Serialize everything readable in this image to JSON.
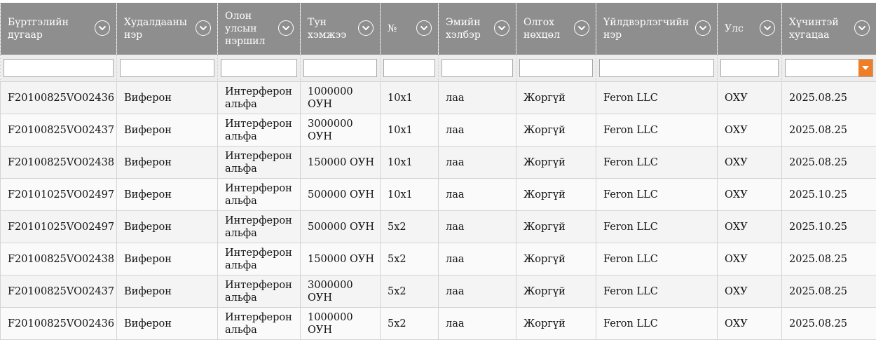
{
  "columns": [
    {
      "label": "Бүртгэлийн дугаар"
    },
    {
      "label": "Худалдааны нэр"
    },
    {
      "label": "Олон улсын нэршил"
    },
    {
      "label": "Тун хэмжээ"
    },
    {
      "label": "№"
    },
    {
      "label": "Эмийн хэлбэр"
    },
    {
      "label": "Олгох нөхцөл"
    },
    {
      "label": "Үйлдвэрлэгчийн нэр"
    },
    {
      "label": "Улс"
    },
    {
      "label": "Хүчинтэй хугацаа"
    }
  ],
  "icons": {
    "sort": "chevron-down-icon",
    "date_picker": "caret-down-icon"
  },
  "colors": {
    "header_bg": "#8e8e8e",
    "accent": "#f07e26"
  },
  "filters": [
    "",
    "",
    "",
    "",
    "",
    "",
    "",
    "",
    "",
    ""
  ],
  "rows": [
    [
      "F20100825VO02436",
      "Виферон",
      "Интерферон альфа",
      "1000000 ОУН",
      "10x1",
      "лаа",
      "Жоргүй",
      "Feron LLC",
      "ОХУ",
      "2025.08.25"
    ],
    [
      "F20100825VO02437",
      "Виферон",
      "Интерферон альфа",
      "3000000 ОУН",
      "10x1",
      "лаа",
      "Жоргүй",
      "Feron LLC",
      "ОХУ",
      "2025.08.25"
    ],
    [
      "F20100825VO02438",
      "Виферон",
      "Интерферон альфа",
      "150000 ОУН",
      "10x1",
      "лаа",
      "Жоргүй",
      "Feron LLC",
      "ОХУ",
      "2025.08.25"
    ],
    [
      "F20101025VO02497",
      "Виферон",
      "Интерферон альфа",
      "500000 ОУН",
      "10x1",
      "лаа",
      "Жоргүй",
      "Feron LLC",
      "ОХУ",
      "2025.10.25"
    ],
    [
      "F20101025VO02497",
      "Виферон",
      "Интерферон альфа",
      "500000 ОУН",
      "5x2",
      "лаа",
      "Жоргүй",
      "Feron LLC",
      "ОХУ",
      "2025.10.25"
    ],
    [
      "F20100825VO02438",
      "Виферон",
      "Интерферон альфа",
      "150000 ОУН",
      "5x2",
      "лаа",
      "Жоргүй",
      "Feron LLC",
      "ОХУ",
      "2025.08.25"
    ],
    [
      "F20100825VO02437",
      "Виферон",
      "Интерферон альфа",
      "3000000 ОУН",
      "5x2",
      "лаа",
      "Жоргүй",
      "Feron LLC",
      "ОХУ",
      "2025.08.25"
    ],
    [
      "F20100825VO02436",
      "Виферон",
      "Интерферон альфа",
      "1000000 ОУН",
      "5x2",
      "лаа",
      "Жоргүй",
      "Feron LLC",
      "ОХУ",
      "2025.08.25"
    ]
  ]
}
